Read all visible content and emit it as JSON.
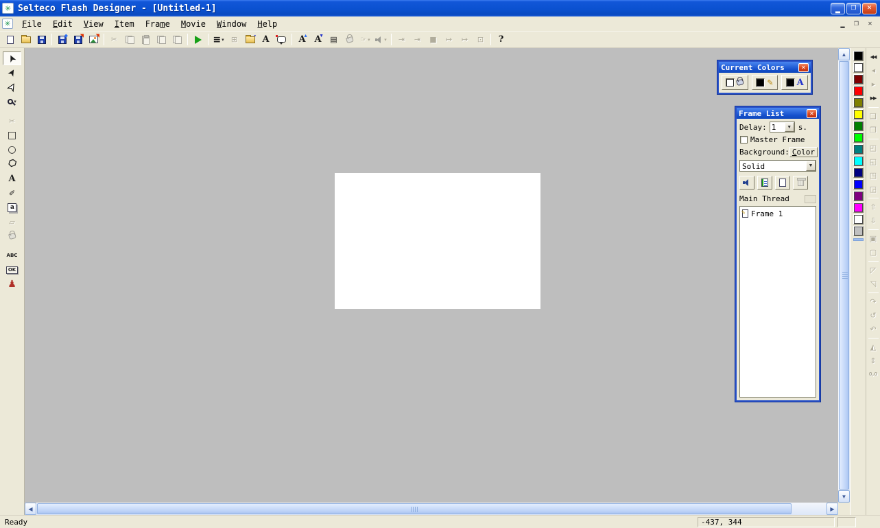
{
  "window": {
    "title": "Selteco Flash Designer - [Untitled-1]",
    "controls": [
      {
        "name": "minimize-button",
        "kind": "min",
        "glyph": "▂"
      },
      {
        "name": "restore-button",
        "kind": "restore",
        "glyph": "❐"
      },
      {
        "name": "close-button",
        "kind": "close",
        "glyph": "✕"
      }
    ]
  },
  "mdi": {
    "controls": [
      {
        "name": "mdi-minimize-button",
        "kind": "min",
        "glyph": "▂"
      },
      {
        "name": "mdi-restore-button",
        "kind": "restore",
        "glyph": "❐"
      },
      {
        "name": "mdi-close-button",
        "kind": "close",
        "glyph": "✕"
      }
    ]
  },
  "menubar": {
    "items": [
      {
        "label": "File",
        "u": 0
      },
      {
        "label": "Edit",
        "u": 0
      },
      {
        "label": "View",
        "u": 0
      },
      {
        "label": "Item",
        "u": 0
      },
      {
        "label": "Frame",
        "u": 3
      },
      {
        "label": "Movie",
        "u": 0
      },
      {
        "label": "Window",
        "u": 0
      },
      {
        "label": "Help",
        "u": 0
      }
    ]
  },
  "toolbar": {
    "items": [
      {
        "name": "new-button",
        "cls": "ic-page"
      },
      {
        "name": "open-button",
        "cls": "ic-folder"
      },
      {
        "name": "save-button",
        "cls": "ic-floppy"
      },
      {
        "sep": true
      },
      {
        "name": "export-flash-button",
        "cls": "ic-floppy",
        "badge": "◆",
        "badgeColor": "#2a6df5"
      },
      {
        "name": "publish-button",
        "cls": "ic-floppy",
        "badge": "◥",
        "badgeColor": "#e03000"
      },
      {
        "name": "export-image-button",
        "cls": "ic-img",
        "badge": "◥",
        "badgeColor": "#e03000"
      },
      {
        "sep": true
      },
      {
        "name": "cut-button",
        "glyph": "✂",
        "disabled": true
      },
      {
        "name": "copy-button",
        "cls": "ic-copy",
        "disabled": true
      },
      {
        "name": "paste-button",
        "cls": "ic-paste",
        "disabled": true
      },
      {
        "name": "duplicate-button",
        "cls": "ic-copy",
        "disabled": true
      },
      {
        "name": "clone-frame-button",
        "cls": "ic-copy",
        "disabled": true
      },
      {
        "sep": true
      },
      {
        "name": "play-movie-button",
        "cls": "ic-play"
      },
      {
        "sep": true
      },
      {
        "name": "line-width-button",
        "glyph": "≡",
        "big": true,
        "dd": true
      },
      {
        "name": "fit-page-button",
        "glyph": "⊞",
        "disabled": true
      },
      {
        "name": "style-button",
        "cls": "ic-folder",
        "badge": "▪",
        "badgeColor": "#2030c8"
      },
      {
        "name": "insert-text-button",
        "glyph": "A",
        "serif": true
      },
      {
        "name": "insert-bubble-button",
        "cls": "ic-bubble"
      },
      {
        "sep": true
      },
      {
        "name": "font-larger-button",
        "glyph": "A",
        "serif": true,
        "badge": "▲",
        "badgeColor": "#2a6df5"
      },
      {
        "name": "font-smaller-button",
        "glyph": "A",
        "serif": true,
        "badge": "▼",
        "badgeColor": "#2030c8"
      },
      {
        "name": "frame-panel-button",
        "glyph": "▤"
      },
      {
        "name": "fill-style-button",
        "cls": "ic-pour",
        "disabled": true
      },
      {
        "name": "hand-button",
        "glyph": "☞",
        "disabled": true,
        "dd": true
      },
      {
        "name": "sound-button",
        "cls": "ic-speaker",
        "disabled": true,
        "dd": true
      },
      {
        "sep": true
      },
      {
        "name": "enter-frame-button",
        "glyph": "⇥",
        "disabled": true
      },
      {
        "name": "enter-frame-alt-button",
        "glyph": "⇥",
        "disabled": true
      },
      {
        "name": "stop-button",
        "glyph": "■",
        "disabled": true
      },
      {
        "name": "exit-frame-button",
        "glyph": "↦",
        "disabled": true
      },
      {
        "name": "exit-frame-alt-button",
        "glyph": "↦",
        "disabled": true
      },
      {
        "name": "frame-target-button",
        "glyph": "⊡",
        "disabled": true
      },
      {
        "sep": true
      },
      {
        "name": "help-button",
        "glyph": "?",
        "serif": true,
        "big": true,
        "color": "#111"
      }
    ]
  },
  "left_tools": {
    "items": [
      {
        "name": "select-tool",
        "glyph": "➤",
        "rot": -115,
        "selected": true,
        "big": true
      },
      {
        "name": "direct-select-tool",
        "glyph": "➤",
        "rot": -60,
        "big": true
      },
      {
        "name": "outline-select-tool",
        "glyph": "➤",
        "rot": -60,
        "outline": true,
        "big": true
      },
      {
        "name": "zoom-tool",
        "cls": "ic-mag",
        "dd": true
      },
      {
        "gap": true
      },
      {
        "name": "scissors-tool",
        "glyph": "✂",
        "disabled": true
      },
      {
        "name": "rectangle-tool",
        "glyph": "□",
        "big": true
      },
      {
        "name": "ellipse-tool",
        "glyph": "○",
        "big": true
      },
      {
        "name": "polygon-tool",
        "cls": "ic-poly"
      },
      {
        "name": "text-tool",
        "glyph": "A",
        "serif": true,
        "big": true
      },
      {
        "name": "eyedropper-tool",
        "glyph": "✐"
      },
      {
        "name": "text-field-tool",
        "cls": "ic-abox"
      },
      {
        "name": "eraser-tool",
        "glyph": "▱",
        "disabled": true
      },
      {
        "name": "fill-tool",
        "cls": "ic-pour",
        "disabled": true
      },
      {
        "gap": true
      },
      {
        "name": "abc-tool",
        "glyph": "ABC",
        "tiny": true
      },
      {
        "name": "ok-button-tool",
        "glyph": "OK",
        "tiny": true,
        "boxed": true
      },
      {
        "name": "actor-tool",
        "glyph": "♟",
        "color": "#b03028",
        "big": true
      }
    ]
  },
  "right_tools": {
    "items": [
      {
        "name": "first-frame-button",
        "glyph": "◀◀",
        "small": true
      },
      {
        "name": "prev-frame-button",
        "glyph": "◀",
        "small": true,
        "disabled": true
      },
      {
        "name": "next-frame-button",
        "glyph": "▶",
        "small": true,
        "disabled": true
      },
      {
        "name": "last-frame-button",
        "glyph": "▶▶",
        "small": true
      },
      {
        "sep": true
      },
      {
        "name": "copy-to-next-button",
        "glyph": "❏",
        "disabled": true
      },
      {
        "name": "copy-to-prev-button",
        "glyph": "❐",
        "disabled": true
      },
      {
        "sep": true
      },
      {
        "name": "snap-top-left-button",
        "glyph": "◰",
        "disabled": true
      },
      {
        "name": "snap-bottom-left-button",
        "glyph": "◱",
        "disabled": true
      },
      {
        "name": "snap-bottom-right-button",
        "glyph": "◳",
        "disabled": true
      },
      {
        "name": "snap-top-right-button",
        "glyph": "◲",
        "disabled": true
      },
      {
        "sep": true
      },
      {
        "name": "raise-item-button",
        "glyph": "⇧",
        "disabled": true
      },
      {
        "name": "lower-item-button",
        "glyph": "⇩",
        "disabled": true
      },
      {
        "sep": true
      },
      {
        "name": "group-button",
        "glyph": "▣",
        "disabled": true
      },
      {
        "name": "ungroup-button",
        "glyph": "▢",
        "disabled": true
      },
      {
        "sep": true
      },
      {
        "name": "scale-button",
        "glyph": "◸",
        "disabled": true
      },
      {
        "name": "scale-keep-button",
        "glyph": "◹",
        "disabled": true
      },
      {
        "sep": true
      },
      {
        "name": "rotate-cw-button",
        "glyph": "↷",
        "disabled": true
      },
      {
        "name": "rotate-ccw-button",
        "glyph": "↺",
        "disabled": true
      },
      {
        "name": "rotate-reset-button",
        "glyph": "↶",
        "disabled": true
      },
      {
        "sep": true
      },
      {
        "name": "flip-horizontal-button",
        "glyph": "◭",
        "disabled": true
      },
      {
        "name": "flip-vertical-button",
        "glyph": "⇕",
        "disabled": true
      },
      {
        "name": "origin-button",
        "glyph": "0,0",
        "tiny": true,
        "disabled": true
      }
    ]
  },
  "palette_strip": {
    "colors": [
      "#000000",
      "#ffffff",
      "#800000",
      "#ff0000",
      "#808000",
      "#ffff00",
      "#008000",
      "#00ff00",
      "#008080",
      "#00ffff",
      "#000080",
      "#0000ff",
      "#800080",
      "#ff00ff",
      "#ffffff",
      "#c0c0c0"
    ]
  },
  "current_colors": {
    "title": "Current Colors",
    "buttons": [
      {
        "name": "fill-color-button",
        "swatch": "#ffffff",
        "icon": "pour"
      },
      {
        "name": "line-color-button",
        "swatch": "#000000",
        "icon": "pen"
      },
      {
        "name": "text-color-button",
        "swatch": "#000000",
        "icon": "A"
      }
    ]
  },
  "frame_list": {
    "title": "Frame List",
    "delay_label": "Delay:",
    "delay_value": "1",
    "delay_unit": "s.",
    "master_frame_label": "Master Frame",
    "background_label": "Background:",
    "color_button_label": "Color",
    "fill_mode": "Solid",
    "main_thread_label": "Main Thread",
    "frames": [
      {
        "label": "Frame 1"
      }
    ]
  },
  "statusbar": {
    "ready": "Ready",
    "coords": "-437, 344"
  },
  "colors": {
    "titlebar_blue": "#0b51d0",
    "canvas_gray": "#bebebe",
    "chrome_beige": "#ece9d8",
    "page_white": "#ffffff"
  }
}
